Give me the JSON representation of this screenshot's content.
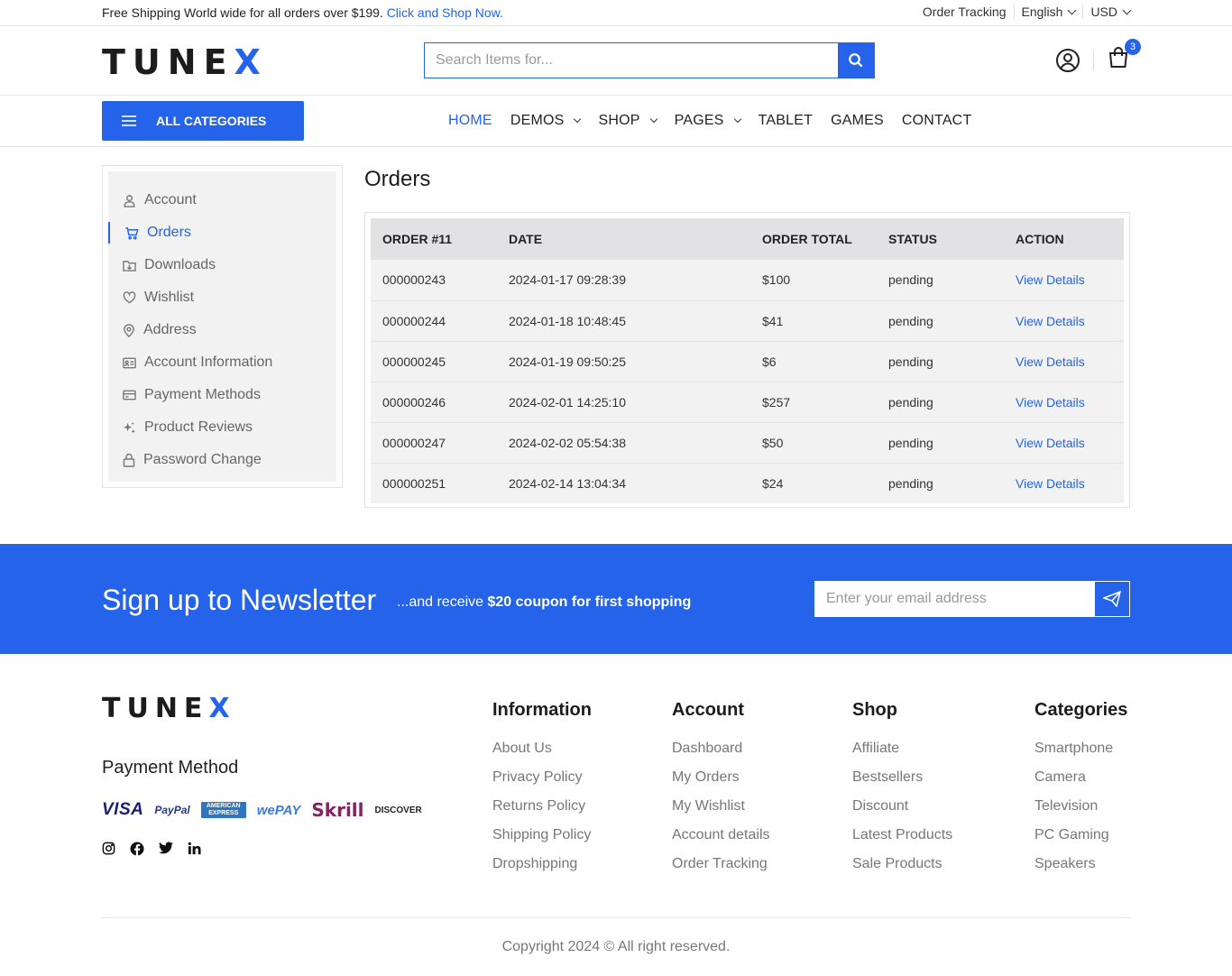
{
  "topbar": {
    "message": "Free Shipping World wide for all orders over $199.",
    "message_link": "Click and Shop Now.",
    "order_tracking": "Order Tracking",
    "language": "English",
    "currency": "USD"
  },
  "header": {
    "logo_main": "TUNE",
    "logo_accent": "X",
    "search_placeholder": "Search Items for...",
    "cart_count": "3"
  },
  "nav": {
    "all_categories": "ALL CATEGORIES",
    "items": [
      {
        "label": "HOME"
      },
      {
        "label": "DEMOS"
      },
      {
        "label": "SHOP"
      },
      {
        "label": "PAGES"
      },
      {
        "label": "TABLET"
      },
      {
        "label": "GAMES"
      },
      {
        "label": "CONTACT"
      }
    ]
  },
  "sidebar": {
    "items": [
      {
        "label": "Account",
        "icon": "user-icon"
      },
      {
        "label": "Orders",
        "icon": "cart-icon"
      },
      {
        "label": "Downloads",
        "icon": "download-folder-icon"
      },
      {
        "label": "Wishlist",
        "icon": "heart-icon"
      },
      {
        "label": "Address",
        "icon": "map-pin-icon"
      },
      {
        "label": "Account Information",
        "icon": "id-card-icon"
      },
      {
        "label": "Payment Methods",
        "icon": "credit-card-icon"
      },
      {
        "label": "Product Reviews",
        "icon": "sparkle-icon"
      },
      {
        "label": "Password Change",
        "icon": "lock-icon"
      }
    ]
  },
  "orders": {
    "title": "Orders",
    "headers": [
      "ORDER #11",
      "DATE",
      "ORDER TOTAL",
      "STATUS",
      "ACTION"
    ],
    "rows": [
      {
        "id": "000000243",
        "date": "2024-01-17 09:28:39",
        "total": "$100",
        "status": "pending",
        "action": "View Details"
      },
      {
        "id": "000000244",
        "date": "2024-01-18 10:48:45",
        "total": "$41",
        "status": "pending",
        "action": "View Details"
      },
      {
        "id": "000000245",
        "date": "2024-01-19 09:50:25",
        "total": "$6",
        "status": "pending",
        "action": "View Details"
      },
      {
        "id": "000000246",
        "date": "2024-02-01 14:25:10",
        "total": "$257",
        "status": "pending",
        "action": "View Details"
      },
      {
        "id": "000000247",
        "date": "2024-02-02 05:54:38",
        "total": "$50",
        "status": "pending",
        "action": "View Details"
      },
      {
        "id": "000000251",
        "date": "2024-02-14 13:04:34",
        "total": "$24",
        "status": "pending",
        "action": "View Details"
      }
    ]
  },
  "newsletter": {
    "title": "Sign up to Newsletter",
    "sub_prefix": "...and receive ",
    "sub_bold": "$20 coupon for first shopping",
    "placeholder": "Enter your email address"
  },
  "footer": {
    "payment_title": "Payment Method",
    "payments": [
      "VISA",
      "PayPal",
      "AMERICAN EXPRESS",
      "wePAY",
      "Skrill",
      "DISCOVER"
    ],
    "columns": [
      {
        "title": "Information",
        "links": [
          "About Us",
          "Privacy Policy",
          "Returns Policy",
          "Shipping Policy",
          "Dropshipping"
        ]
      },
      {
        "title": "Account",
        "links": [
          "Dashboard",
          "My Orders",
          "My Wishlist",
          "Account details",
          "Order Tracking"
        ]
      },
      {
        "title": "Shop",
        "links": [
          "Affiliate",
          "Bestsellers",
          "Discount",
          "Latest Products",
          "Sale Products"
        ]
      },
      {
        "title": "Categories",
        "links": [
          "Smartphone",
          "Camera",
          "Television",
          "PC Gaming",
          "Speakers"
        ]
      }
    ],
    "copyright": "Copyright 2024 © All right reserved."
  },
  "colors": {
    "accent": "#2563eb",
    "text": "#222222",
    "muted": "#777777"
  }
}
